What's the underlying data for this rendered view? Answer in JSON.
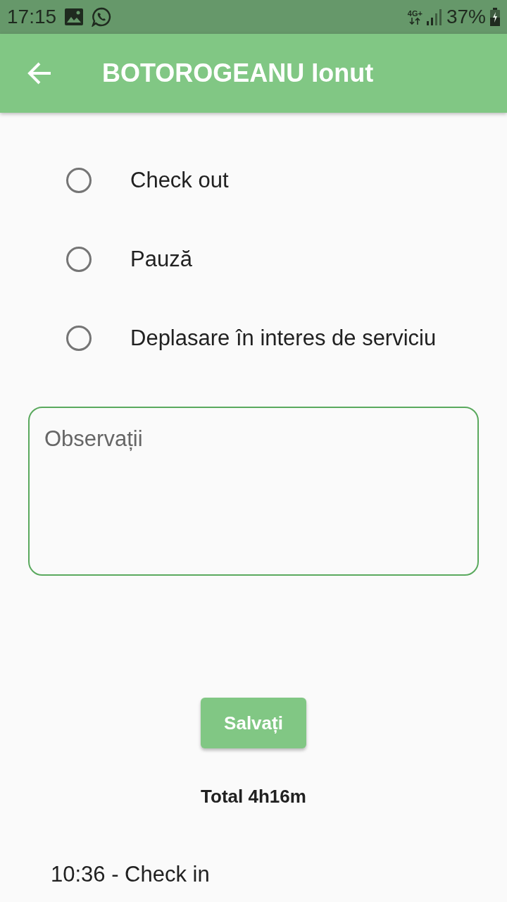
{
  "status_bar": {
    "time": "17:15",
    "network": "4G+",
    "battery": "37%"
  },
  "app_bar": {
    "title": "BOTOROGEANU Ionut"
  },
  "options": [
    {
      "label": "Check out",
      "selected": false
    },
    {
      "label": "Pauză",
      "selected": false
    },
    {
      "label": "Deplasare în interes de serviciu",
      "selected": false
    }
  ],
  "notes_field": {
    "placeholder": "Observații"
  },
  "save_button": {
    "label": "Salvați"
  },
  "total": "Total 4h16m",
  "log": [
    {
      "text": "10:36 - Check in"
    }
  ]
}
